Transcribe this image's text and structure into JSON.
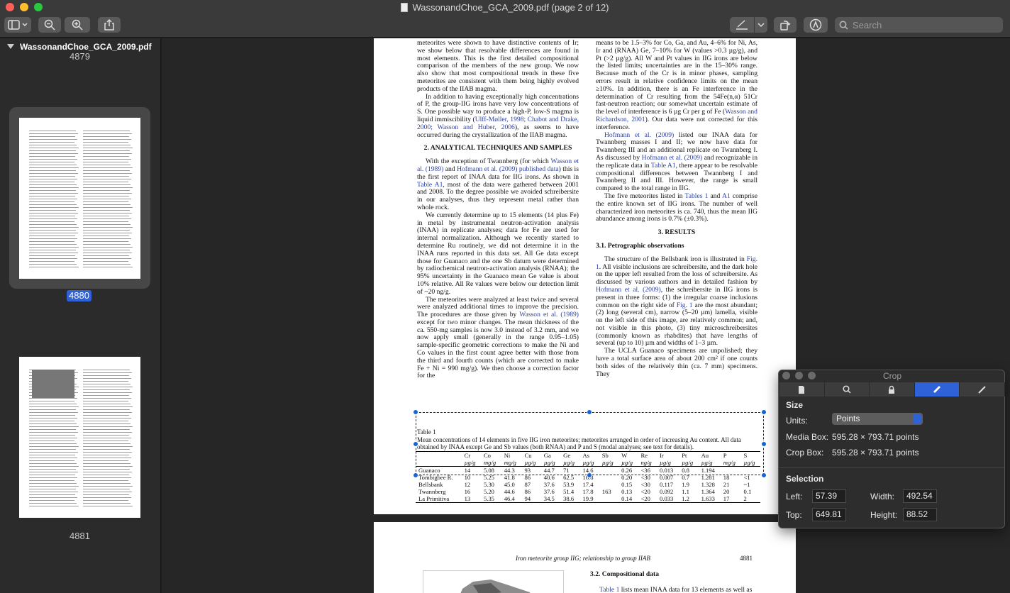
{
  "window": {
    "title": "WassonandChoe_GCA_2009.pdf (page 2 of 12)"
  },
  "toolbar": {
    "search_placeholder": "Search"
  },
  "sidebar": {
    "file_name": "WassonandChoe_GCA_2009.pdf",
    "pages": [
      {
        "label": "4879",
        "selected": false
      },
      {
        "label": "4880",
        "selected": true
      },
      {
        "label": "4881",
        "selected": false
      }
    ]
  },
  "document": {
    "page2": {
      "left_col_top": "meteorites were shown to have distinctive contents of Ir; we show below that resolvable differences are found in most elements. This is the first detailed compositional comparison of the members of the new group. We now also show that most compositional trends in these five meteorites are consistent with them being highly evolved products of the IIAB magma.",
      "left_p2_a": "In addition to having exceptionally high concentrations of P, the group-IIG irons have very low concentrations of S. One possible way to produce a high-P, low-S magma is liquid immiscibility (",
      "left_p2_link": "Ulff-Møller, 1998; Chabot and Drake, 2000; Wasson and Huber, 2006",
      "left_p2_b": "), as seems to have occurred during the crystallization of the IIAB magma.",
      "sec2_title": "2. ANALYTICAL TECHNIQUES AND SAMPLES",
      "left_p3_a": "With the exception of Twannberg (for which ",
      "left_p3_link1": "Wasson et al. (1989)",
      "left_p3_b": " and ",
      "left_p3_link2": "Hofmann et al. (2009) published data",
      "left_p3_c": ") this is the first report of INAA data for IIG irons. As shown in ",
      "left_p3_link3": "Table A1",
      "left_p3_d": ", most of the data were gathered between 2001 and 2008. To the degree possible we avoided schreibersite in our analyses, thus they represent metal rather than whole rock.",
      "left_p4": "We currently determine up to 15 elements (14 plus Fe) in metal by instrumental neutron-activation analysis (INAA) in replicate analyses; data for Fe are used for internal normalization. Although we recently started to determine Ru routinely, we did not determine it in the INAA runs reported in this data set. All Ge data except those for Guanaco and the one Sb datum were determined by radiochemical neutron-activation analysis (RNAA); the 95% uncertainty in the Guanaco mean Ge value is about 10% relative. All Re values were below our detection limit of ~20 ng/g.",
      "left_p5_a": "The meteorites were analyzed at least twice and several were analyzed additional times to improve the precision. The procedures are those given by ",
      "left_p5_link": "Wasson et al. (1989)",
      "left_p5_b": " except for two minor changes. The mean thickness of the ca. 550-mg samples is now 3.0 instead of 3.2 mm, and we now apply small (generally in the range 0.95–1.05) sample-specific geometric corrections to make the Ni and Co values in the first count agree better with those from the third and fourth counts (which are corrected to make Fe + Ni = 990 mg/g). We then choose a correction factor for the",
      "right_p1_a": "means to be 1.5–3% for Co, Ga, and Au, 4–6% for Ni, As, Ir and (RNAA) Ge, 7–10% for W (values >0.3 µg/g), and Pt (>2 µg/g). All W and Pt values in IIG irons are below the listed limits; uncertainties are in the 15–30% range. Because much of the Cr is in minor phases, sampling errors result in relative confidence limits on the mean ≥10%. In addition, there is an Fe interference in the determination of Cr resulting from the 54Fe(n,α) 51Cr fast-neutron reaction; our somewhat uncertain estimate of the level of interference is 6 µg Cr per g of Fe (",
      "right_p1_link": "Wasson and Richardson, 2001",
      "right_p1_b": "). Our data were not corrected for this interference.",
      "right_p2_link1": "Hofmann et al. (2009)",
      "right_p2_a": " listed our INAA data for Twannberg masses I and II; we now have data for Twannberg III and an additional replicate on Twannberg I. As discussed by ",
      "right_p2_link2": "Hofmann et al. (2009)",
      "right_p2_b": " and recognizable in the replicate data in ",
      "right_p2_link3": "Table A1",
      "right_p2_c": ", there appear to be resolvable compositional differences between Twannberg I and Twannberg II and III. However, the range is small compared to the total range in IIG.",
      "right_p3_a": "The five meteorites listed in ",
      "right_p3_link1": "Tables 1",
      "right_p3_b": " and ",
      "right_p3_link2": "A1",
      "right_p3_c": " comprise the entire known set of IIG irons. The number of well characterized iron meteorites is ca. 740, thus the mean IIG abundance among irons is 0.7% (±0.3%).",
      "sec3_title": "3. RESULTS",
      "subsec31": "3.1. Petrographic observations",
      "right_p4_a": "The structure of the Bellsbank iron is illustrated in ",
      "right_p4_link1": "Fig. 1",
      "right_p4_b": ". All visible inclusions are schreibersite, and the dark hole on the upper left resulted from the loss of schreibersite. As discussed by various authors and in detailed fashion by ",
      "right_p4_link2": "Hofmann et al. (2009)",
      "right_p4_c": ", the schreibersite in IIG irons is present in three forms: (1) the irregular coarse inclusions common on the right side of ",
      "right_p4_link3": "Fig. 1",
      "right_p4_d": " are the most abundant; (2) long (several cm), narrow (5–20 µm) lamella, visible on the left side of this image, are relatively common; and, not visible in this photo, (3) tiny microschreibersites (commonly known as rhabdites) that have lengths of several (up to 10) µm and widths of 1–3 µm.",
      "right_p5": "The UCLA Guanaco specimens are unpolished; they have a total surface area of about 200 cm² if one counts both sides of the relatively thin (ca. 7 mm) specimens. They",
      "table_label": "Table 1",
      "table_caption": "Mean concentrations of 14 elements in five IIG iron meteorites; meteorites arranged in order of increasing Au content. All data obtained by INAA except Ge and Sb values (both RNAA) and P and S (modal analyses; see text for details).",
      "table_headers": [
        "",
        "Cr",
        "Co",
        "Ni",
        "Cu",
        "Ga",
        "Ge",
        "As",
        "Sb",
        "W",
        "Re",
        "Ir",
        "Pt",
        "Au",
        "P",
        "S"
      ],
      "table_units": [
        "",
        "µg/g",
        "mg/g",
        "mg/g",
        "µg/g",
        "µg/g",
        "µg/g",
        "µg/g",
        "µg/g",
        "µg/g",
        "ng/g",
        "µg/g",
        "µg/g",
        "µg/g",
        "mg/g",
        "µg/g"
      ],
      "table_rows": [
        [
          "Guanaco",
          "14",
          "5.08",
          "44.3",
          "93",
          "44.7",
          "71",
          "14.6",
          "",
          "0.26",
          "<36",
          "0.013",
          "0.8",
          "1.194",
          "",
          ""
        ],
        [
          "Tombigbee R.",
          "10",
          "5.25",
          "41.8",
          "86",
          "40.6",
          "62.5",
          "16.8",
          "",
          "0.20",
          "<30",
          "0.007",
          "0.7",
          "1.281",
          "18",
          "<1"
        ],
        [
          "Bellsbank",
          "12",
          "5.30",
          "45.0",
          "87",
          "37.6",
          "53.9",
          "17.4",
          "",
          "0.15",
          "<30",
          "0.117",
          "1.9",
          "1.328",
          "21",
          "~1"
        ],
        [
          "Twannberg",
          "16",
          "5.20",
          "44.6",
          "86",
          "37.6",
          "51.4",
          "17.8",
          "163",
          "0.13",
          "<20",
          "0.092",
          "1.1",
          "1.364",
          "20",
          "0.1"
        ],
        [
          "La Primitiva",
          "13",
          "5.35",
          "46.4",
          "94",
          "34.5",
          "38.6",
          "19.9",
          "",
          "0.14",
          "<20",
          "0.033",
          "1.2",
          "1.633",
          "17",
          "2"
        ]
      ]
    },
    "page3": {
      "running_header": "Iron meteorite group IIG; relationship to group IIAB",
      "page_number": "4881",
      "subsec32": "3.2. Compositional data",
      "p1_link": "Table 1",
      "p1_text": " lists mean INAA data for 13 elements as well as"
    }
  },
  "crop_panel": {
    "title": "Crop",
    "size_heading": "Size",
    "units_label": "Units:",
    "units_value": "Points",
    "media_box_label": "Media Box:",
    "media_box_value": "595.28 × 793.71 points",
    "crop_box_label": "Crop Box:",
    "crop_box_value": "595.28 × 793.71 points",
    "selection_heading": "Selection",
    "left_label": "Left:",
    "left_value": "57.39",
    "width_label": "Width:",
    "width_value": "492.54",
    "top_label": "Top:",
    "top_value": "649.81",
    "height_label": "Height:",
    "height_value": "88.52"
  },
  "colors": {
    "accent": "#2f62d8",
    "link": "#2a3fa4",
    "handle": "#1565d8"
  }
}
